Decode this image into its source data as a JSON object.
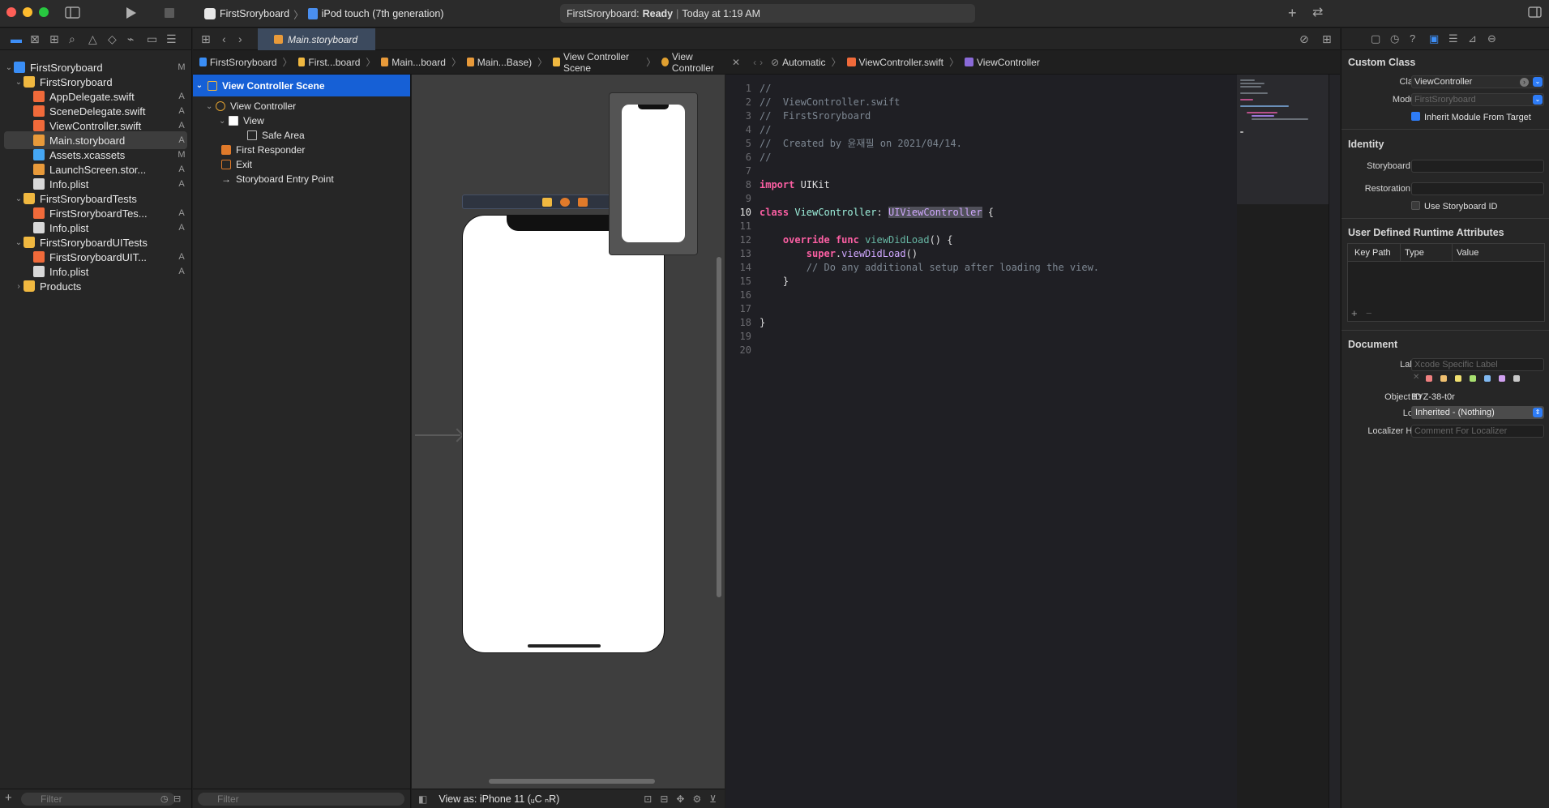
{
  "toolbar": {
    "scheme": "FirstSroryboard",
    "device": "iPod touch (7th generation)",
    "activity_project": "FirstSroryboard:",
    "activity_status": "Ready",
    "activity_time": "Today at 1:19 AM"
  },
  "editor_tab": {
    "label": "Main.storyboard"
  },
  "navigator": {
    "items": [
      {
        "label": "FirstSroryboard",
        "badge": "M"
      },
      {
        "label": "FirstSroryboard",
        "badge": ""
      },
      {
        "label": "AppDelegate.swift",
        "badge": "A"
      },
      {
        "label": "SceneDelegate.swift",
        "badge": "A"
      },
      {
        "label": "ViewController.swift",
        "badge": "A"
      },
      {
        "label": "Main.storyboard",
        "badge": "A"
      },
      {
        "label": "Assets.xcassets",
        "badge": "M"
      },
      {
        "label": "LaunchScreen.stor...",
        "badge": "A"
      },
      {
        "label": "Info.plist",
        "badge": "A"
      },
      {
        "label": "FirstSroryboardTests",
        "badge": ""
      },
      {
        "label": "FirstSroryboardTes...",
        "badge": "A"
      },
      {
        "label": "Info.plist",
        "badge": "A"
      },
      {
        "label": "FirstSroryboardUITests",
        "badge": ""
      },
      {
        "label": "FirstSroryboardUIT...",
        "badge": "A"
      },
      {
        "label": "Info.plist",
        "badge": "A"
      },
      {
        "label": "Products",
        "badge": ""
      }
    ],
    "filter_placeholder": "Filter"
  },
  "breadcrumb_storyboard": [
    "FirstSroryboard",
    "First...board",
    "Main...board",
    "Main...Base)",
    "View Controller Scene",
    "View Controller"
  ],
  "breadcrumb_code": [
    "Automatic",
    "ViewController.swift",
    "ViewController"
  ],
  "outline": {
    "items": [
      "View Controller Scene",
      "View Controller",
      "View",
      "Safe Area",
      "First Responder",
      "Exit",
      "Storyboard Entry Point"
    ],
    "filter_placeholder": "Filter"
  },
  "canvas": {
    "view_as": "View as: iPhone 11 (ᵤC ₙR)"
  },
  "code": {
    "lines": [
      {
        "n": "1",
        "html": "<span class=\"cmt\">//</span>"
      },
      {
        "n": "2",
        "html": "<span class=\"cmt\">//  ViewController.swift</span>"
      },
      {
        "n": "3",
        "html": "<span class=\"cmt\">//  FirstSroryboard</span>"
      },
      {
        "n": "4",
        "html": "<span class=\"cmt\">//</span>"
      },
      {
        "n": "5",
        "html": "<span class=\"cmt\">//  Created by 윤재필 on 2021/04/14.</span>"
      },
      {
        "n": "6",
        "html": "<span class=\"cmt\">//</span>"
      },
      {
        "n": "7",
        "html": ""
      },
      {
        "n": "8",
        "html": "<span class=\"kw\">import</span> UIKit"
      },
      {
        "n": "9",
        "html": ""
      },
      {
        "n": "10",
        "html": "<span class=\"kw\">class</span> <span class=\"ty\">ViewController</span>: <span class=\"ty2 hl\">UIViewController</span> {"
      },
      {
        "n": "11",
        "html": ""
      },
      {
        "n": "12",
        "html": "    <span class=\"kw\">override</span> <span class=\"kw\">func</span> <span class=\"fn\">viewDidLoad</span>() {"
      },
      {
        "n": "13",
        "html": "        <span class=\"kw\">super</span>.<span class=\"ty2\">viewDidLoad</span>()"
      },
      {
        "n": "14",
        "html": "        <span class=\"cmt\">// Do any additional setup after loading the view.</span>"
      },
      {
        "n": "15",
        "html": "    }"
      },
      {
        "n": "16",
        "html": ""
      },
      {
        "n": "17",
        "html": ""
      },
      {
        "n": "18",
        "html": "}"
      },
      {
        "n": "19",
        "html": ""
      },
      {
        "n": "20",
        "html": ""
      }
    ],
    "current_line": "10"
  },
  "inspector": {
    "custom_class_title": "Custom Class",
    "class_label": "Class",
    "class_value": "ViewController",
    "module_label": "Module",
    "module_placeholder": "FirstSroryboard",
    "inherit_label": "Inherit Module From Target",
    "identity_title": "Identity",
    "storyboard_id_label": "Storyboard ID",
    "restoration_id_label": "Restoration ID",
    "use_storyboard_id_label": "Use Storyboard ID",
    "udra_title": "User Defined Runtime Attributes",
    "col_keypath": "Key Path",
    "col_type": "Type",
    "col_value": "Value",
    "document_title": "Document",
    "label_label": "Label",
    "label_placeholder": "Xcode Specific Label",
    "object_id_label": "Object ID",
    "object_id_value": "BYZ-38-t0r",
    "lock_label": "Lock",
    "lock_value": "Inherited - (Nothing)",
    "localizer_label": "Localizer Hint",
    "localizer_placeholder": "Comment For Localizer"
  },
  "colors": {
    "accent": "#1660d6",
    "traffic_red": "#fe5f57",
    "traffic_yellow": "#febc2e",
    "traffic_green": "#28c840"
  }
}
